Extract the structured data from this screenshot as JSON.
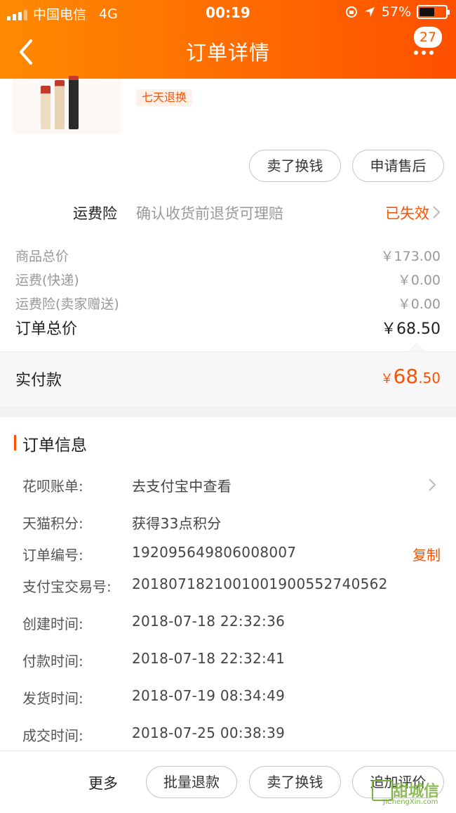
{
  "status_bar": {
    "carrier": "中国电信",
    "network": "4G",
    "time": "00:19",
    "battery_percent": "57%",
    "battery_level": 0.57
  },
  "header": {
    "title": "订单详情",
    "badge_count": "27",
    "icons": [
      "back-arrow-icon",
      "more-dots-icon"
    ]
  },
  "product": {
    "tag": "七天退换",
    "actions": {
      "sell": "卖了换钱",
      "after_sale": "申请售后"
    }
  },
  "insurance": {
    "label": "运费险",
    "description": "确认收货前退货可理赔",
    "status": "已失效"
  },
  "prices": [
    {
      "label": "商品总价",
      "value": "￥173.00"
    },
    {
      "label": "运费(快递)",
      "value": "￥0.00"
    },
    {
      "label": "运费险(卖家赠送)",
      "value": "￥0.00"
    }
  ],
  "order_total": {
    "label": "订单总价",
    "value": "￥68.50"
  },
  "paid": {
    "label": "实付款",
    "currency": "￥",
    "integer": "68",
    "decimal": ".50"
  },
  "order_info": {
    "title": "订单信息",
    "rows": [
      {
        "key": "花呗账单:",
        "value": "去支付宝中查看"
      },
      {
        "key": "天猫积分:",
        "value": "获得33点积分"
      },
      {
        "key": "订单编号:",
        "value": "192095649806008007",
        "action": "复制"
      },
      {
        "key": "支付宝交易号:",
        "value": "2018071821001001900552740562"
      },
      {
        "key": "创建时间:",
        "value": "2018-07-18 22:32:36"
      },
      {
        "key": "付款时间:",
        "value": "2018-07-18 22:32:41"
      },
      {
        "key": "发货时间:",
        "value": "2018-07-19 08:34:49"
      },
      {
        "key": "成交时间:",
        "value": "2018-07-25 00:38:39"
      }
    ]
  },
  "bottom_bar": {
    "more": "更多",
    "buttons": [
      "批量退款",
      "卖了换钱",
      "追加评价"
    ]
  },
  "watermark": {
    "brand": "甜城信",
    "site": "JiChengXin.com"
  },
  "colors": {
    "accent": "#ff5000",
    "header_start": "#ff8a00",
    "header_end": "#ff5000"
  }
}
